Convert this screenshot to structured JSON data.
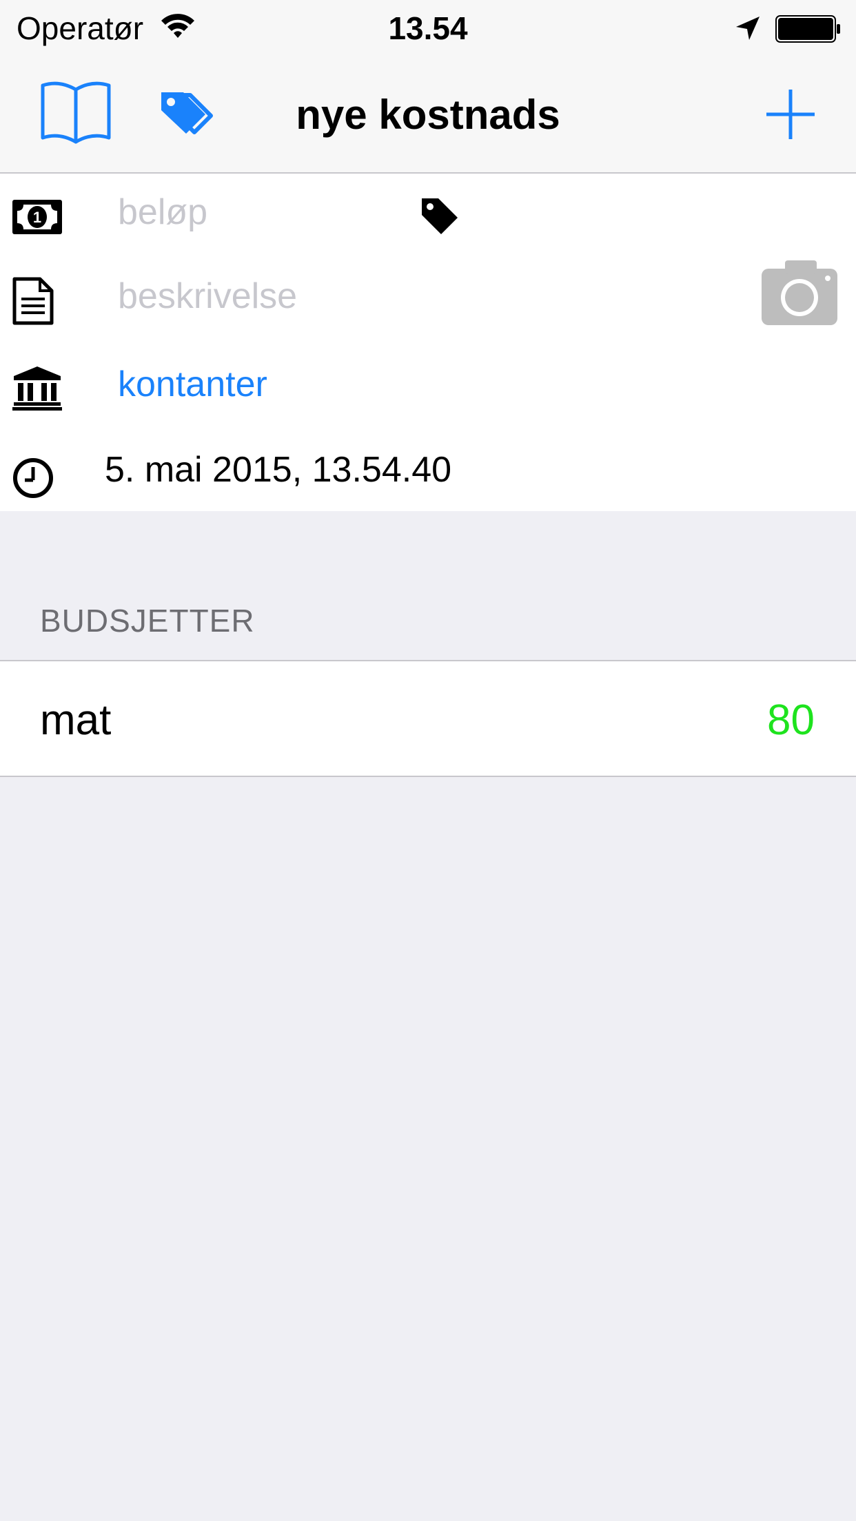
{
  "status_bar": {
    "carrier": "Operatør",
    "time": "13.54"
  },
  "nav": {
    "title": "nye kostnads",
    "left_icons": [
      "book-icon",
      "tags-icon"
    ],
    "right_icon": "plus-icon"
  },
  "form": {
    "amount_placeholder": "beløp",
    "description_placeholder": "beskrivelse",
    "account": "kontanter",
    "date": "5. mai 2015, 13.54.40"
  },
  "budgets": {
    "header": "BUDSJETTER",
    "items": [
      {
        "name": "mat",
        "value": "80"
      }
    ]
  },
  "colors": {
    "accent": "#1a82fb",
    "positive": "#1ee31e",
    "placeholder": "#c7c7cd",
    "background": "#efeff4"
  }
}
